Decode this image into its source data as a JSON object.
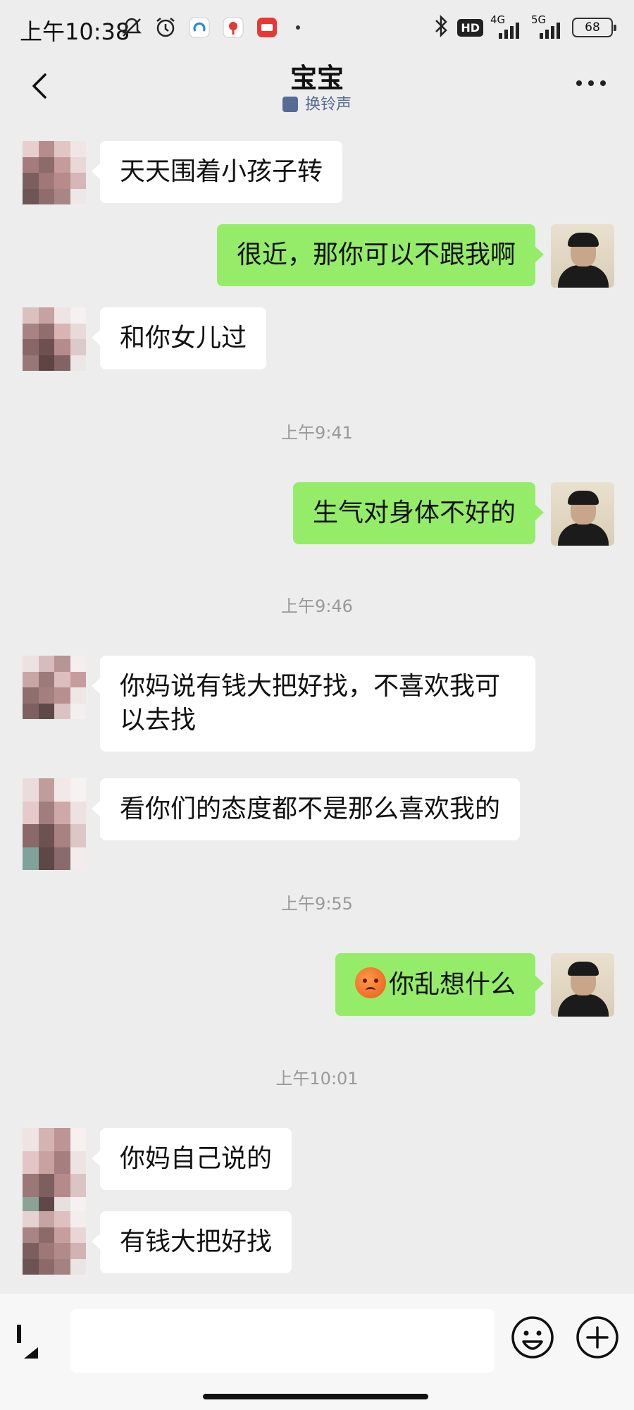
{
  "status_bar": {
    "time": "上午10:38",
    "hd_label": "HD",
    "net1_label": "4G",
    "net2_label": "5G",
    "battery": "68"
  },
  "header": {
    "title": "宝宝",
    "subtitle": "换铃声"
  },
  "messages": [
    {
      "side": "in",
      "text": "天天围着小孩子转"
    },
    {
      "side": "out",
      "text": "很近，那你可以不跟我啊"
    },
    {
      "side": "in",
      "text": "和你女儿过"
    },
    {
      "type": "time",
      "text": "上午9:41"
    },
    {
      "side": "out",
      "text": "生气对身体不好的"
    },
    {
      "type": "time",
      "text": "上午9:46"
    },
    {
      "side": "in",
      "text": "你妈说有钱大把好找，不喜欢我可以去找"
    },
    {
      "side": "in",
      "text": "看你们的态度都不是那么喜欢我的"
    },
    {
      "type": "time",
      "text": "上午9:55"
    },
    {
      "side": "out",
      "text": "你乱想什么",
      "emoji": "worried-face"
    },
    {
      "type": "time",
      "text": "上午10:01"
    },
    {
      "side": "in",
      "text": "你妈自己说的"
    },
    {
      "side": "in",
      "text": "有钱大把好找"
    }
  ],
  "input": {
    "value": "",
    "placeholder": ""
  },
  "colors": {
    "accent_green": "#95ec69",
    "link_blue": "#576b95",
    "background": "#ededed"
  }
}
